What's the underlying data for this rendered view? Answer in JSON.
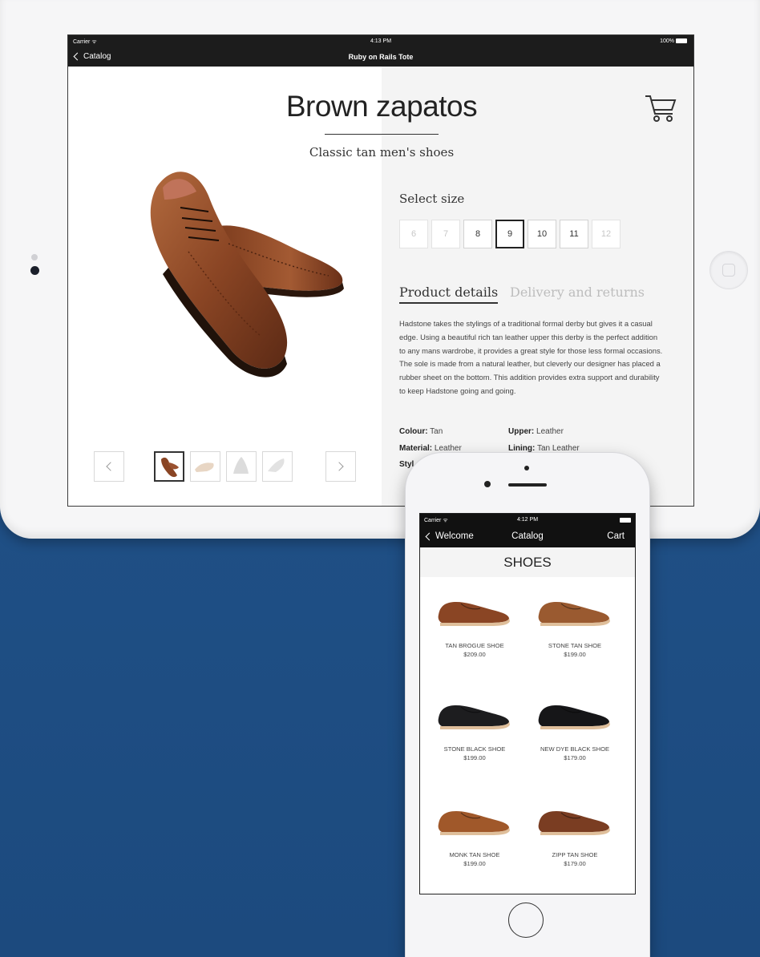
{
  "ipad": {
    "status": {
      "carrier": "Carrier ᯤ",
      "time": "4:13 PM",
      "battery": "100%"
    },
    "nav": {
      "back_label": "Catalog",
      "title": "Ruby on Rails Tote"
    },
    "product": {
      "title": "Brown zapatos",
      "subtitle": "Classic tan men's shoes",
      "select_size_label": "Select size",
      "sizes": [
        {
          "label": "6",
          "state": "disabled"
        },
        {
          "label": "7",
          "state": "disabled"
        },
        {
          "label": "8",
          "state": "available"
        },
        {
          "label": "9",
          "state": "selected"
        },
        {
          "label": "10",
          "state": "available"
        },
        {
          "label": "11",
          "state": "available"
        },
        {
          "label": "12",
          "state": "disabled"
        }
      ],
      "tabs": {
        "details": "Product details",
        "delivery": "Delivery and returns"
      },
      "description": "Hadstone takes the stylings of a traditional formal derby but gives it a casual edge. Using a beautiful rich tan leather upper this derby is the perfect addition to any mans wardrobe, it provides a great style for those less formal occasions. The sole is made from a natural leather, but cleverly our designer has placed a rubber sheet on the bottom. This addition provides extra support and durability to keep Hadstone going and going.",
      "attributes": {
        "colour_label": "Colour:",
        "colour_value": "Tan",
        "upper_label": "Upper:",
        "upper_value": "Leather",
        "material_label": "Material:",
        "material_value": "Leather",
        "lining_label": "Lining:",
        "lining_value": "Tan Leather",
        "style_label_partial": "Styl"
      }
    },
    "icons": {
      "cart": "cart-icon",
      "prev": "chevron-left-icon",
      "next": "chevron-right-icon"
    }
  },
  "iphone": {
    "status": {
      "carrier": "Carrier ᯤ",
      "time": "4:12 PM"
    },
    "nav": {
      "back_label": "Welcome",
      "title": "Catalog",
      "right_label": "Cart"
    },
    "section_title": "SHOES",
    "products": [
      {
        "name": "TAN BROGUE SHOE",
        "price": "$209.00",
        "color": "#8a4524"
      },
      {
        "name": "STONE TAN SHOE",
        "price": "$199.00",
        "color": "#9a5a30"
      },
      {
        "name": "STONE BLACK SHOE",
        "price": "$199.00",
        "color": "#1d1d1f"
      },
      {
        "name": "NEW DYE BLACK SHOE",
        "price": "$179.00",
        "color": "#161618"
      },
      {
        "name": "MONK TAN SHOE",
        "price": "$199.00",
        "color": "#a0582a"
      },
      {
        "name": "ZIPP TAN SHOE",
        "price": "$179.00",
        "color": "#7a3d22"
      }
    ]
  },
  "colors": {
    "background": "#21528a",
    "leather": "#8a4524",
    "nav_bar": "#1c1c1c"
  }
}
